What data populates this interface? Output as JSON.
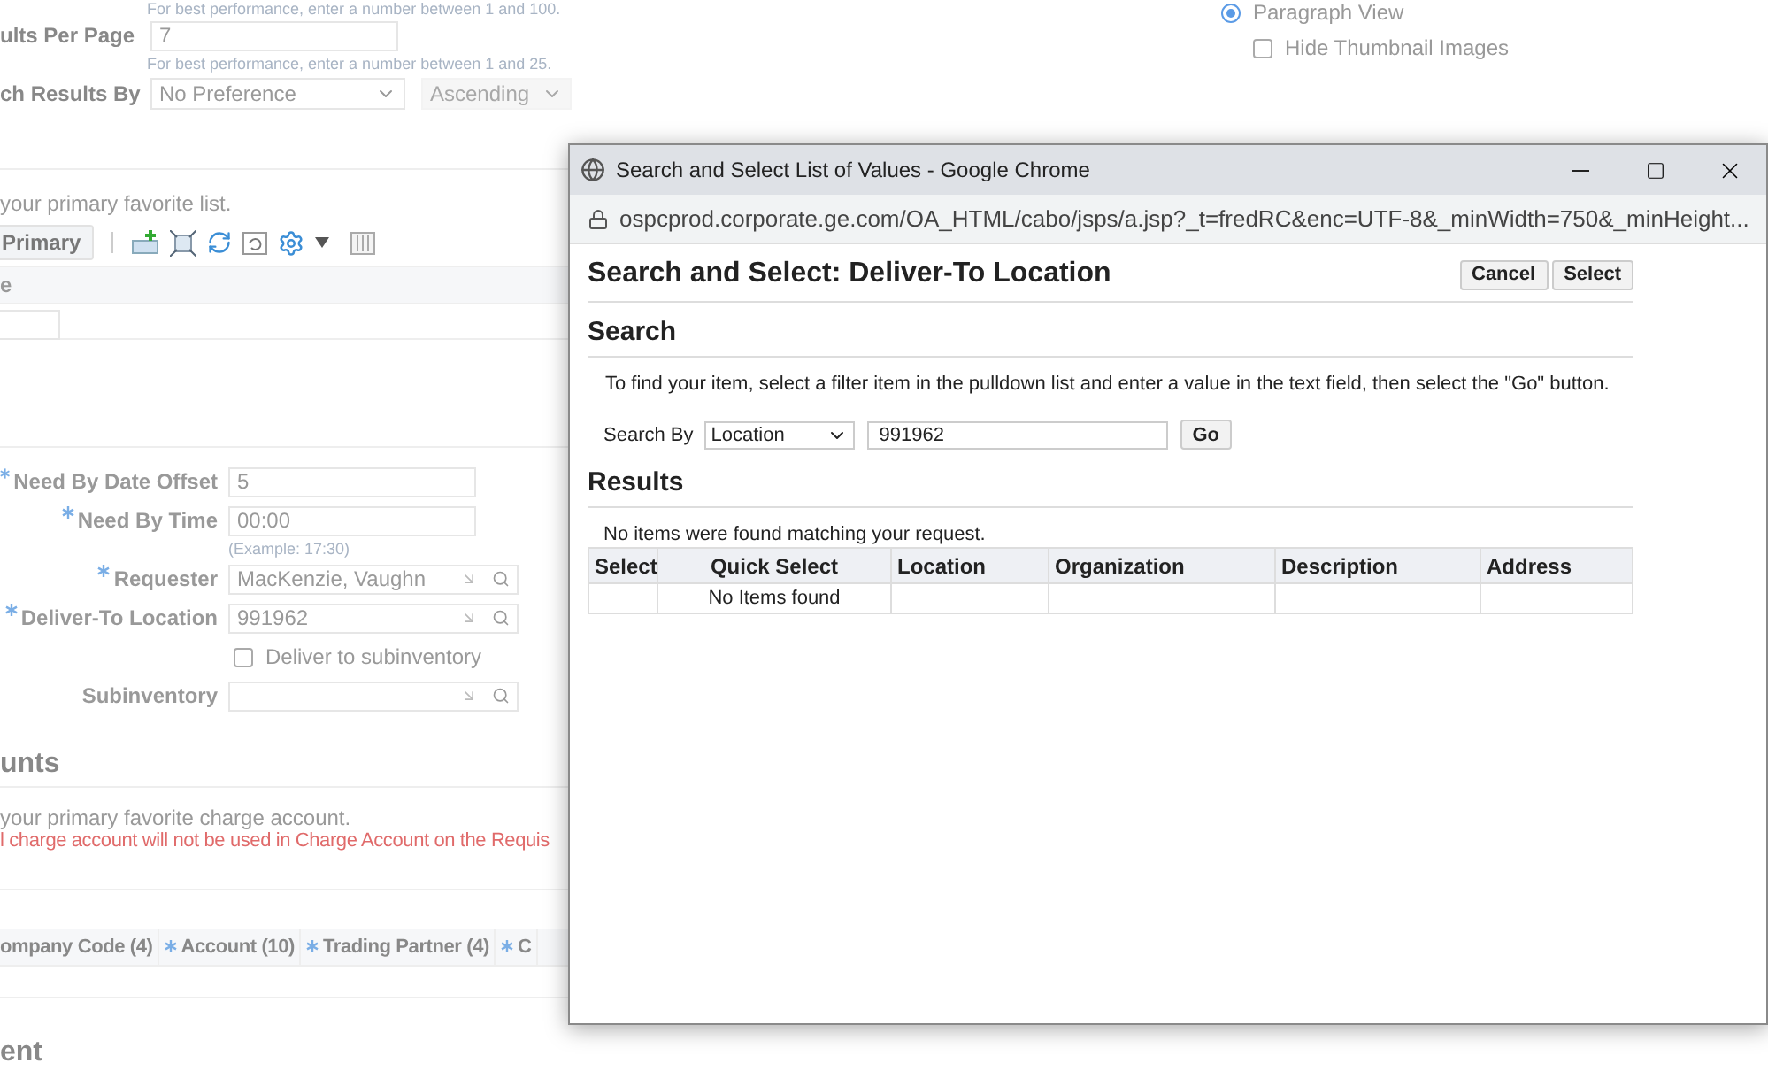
{
  "settings": {
    "hint_1": "For best performance, enter a number between 1 and 100.",
    "results_per_page": {
      "label": "ults Per Page",
      "value": "7"
    },
    "hint_2": "For best performance, enter a number between 1 and 25.",
    "sort": {
      "label": "ch Results By",
      "value": "No Preference",
      "order": "Ascending",
      "order_disabled": true
    }
  },
  "view_options": [
    {
      "kind": "radio",
      "label": "Paragraph View",
      "checked": true
    },
    {
      "kind": "checkbox",
      "label": "Hide Thumbnail Images",
      "checked": false
    }
  ],
  "favorites": {
    "note": "your primary favorite list.",
    "primary_button": "Primary",
    "table_header": "e"
  },
  "delivery_fields": [
    {
      "kind": "text",
      "label": "Need By Date Offset",
      "required": true,
      "value": "5"
    },
    {
      "kind": "text",
      "label": "Need By Time",
      "required": true,
      "value": "00:00",
      "hint": "(Example: 17:30)"
    },
    {
      "kind": "lookup",
      "label": "Requester",
      "required": true,
      "value": "MacKenzie, Vaughn"
    },
    {
      "kind": "lookup",
      "label": "Deliver-To Location",
      "required": true,
      "value": "991962"
    },
    {
      "kind": "checkbox",
      "label": "Deliver to subinventory",
      "checked": false
    },
    {
      "kind": "lookup",
      "label": "Subinventory",
      "required": false
    }
  ],
  "accounts": {
    "heading": "unts",
    "note": "your primary favorite charge account.",
    "warning": "l charge account will not be used in Charge Account on the Requis",
    "columns": [
      {
        "label": "ompany Code (4)",
        "required": false
      },
      {
        "label": "Account (10)",
        "required": true
      },
      {
        "label": "Trading Partner (4)",
        "required": true
      },
      {
        "label": "C",
        "required": true
      }
    ]
  },
  "next_heading": "ent",
  "popup": {
    "window_title": "Search and Select List of Values - Google Chrome",
    "url": "ospcprod.corporate.ge.com/OA_HTML/cabo/jsps/a.jsp?_t=fredRC&enc=UTF-8&_minWidth=750&_minHeight...",
    "title": "Search and Select: Deliver-To Location",
    "buttons": [
      "Cancel",
      "Select"
    ],
    "search_heading": "Search",
    "instructions": "To find your item, select a filter item in the pulldown list and enter a value in the text field, then select the \"Go\" button.",
    "search_by_label": "Search By",
    "search_by": "Location",
    "search_value": "991962",
    "go_button": "Go",
    "results_heading": "Results",
    "results_message": "No items were found matching your request.",
    "columns": [
      "Select",
      "Quick Select",
      "Location",
      "Organization",
      "Description",
      "Address"
    ],
    "empty_row": "No Items found"
  }
}
